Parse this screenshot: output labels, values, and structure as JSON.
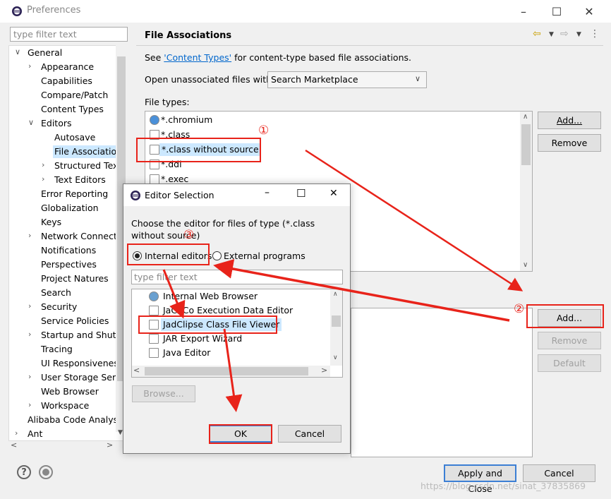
{
  "window": {
    "title": "Preferences"
  },
  "left": {
    "filter_placeholder": "type filter text",
    "tree": [
      {
        "label": "General",
        "depth": 0,
        "twisty": "down"
      },
      {
        "label": "Appearance",
        "depth": 1,
        "twisty": "right"
      },
      {
        "label": "Capabilities",
        "depth": 1,
        "twisty": ""
      },
      {
        "label": "Compare/Patch",
        "depth": 1,
        "twisty": ""
      },
      {
        "label": "Content Types",
        "depth": 1,
        "twisty": ""
      },
      {
        "label": "Editors",
        "depth": 1,
        "twisty": "down"
      },
      {
        "label": "Autosave",
        "depth": 2,
        "twisty": ""
      },
      {
        "label": "File Associations",
        "depth": 2,
        "twisty": "",
        "selected": true
      },
      {
        "label": "Structured Text",
        "depth": 2,
        "twisty": "right"
      },
      {
        "label": "Text Editors",
        "depth": 2,
        "twisty": "right"
      },
      {
        "label": "Error Reporting",
        "depth": 1,
        "twisty": ""
      },
      {
        "label": "Globalization",
        "depth": 1,
        "twisty": ""
      },
      {
        "label": "Keys",
        "depth": 1,
        "twisty": ""
      },
      {
        "label": "Network Connections",
        "depth": 1,
        "twisty": "right"
      },
      {
        "label": "Notifications",
        "depth": 1,
        "twisty": ""
      },
      {
        "label": "Perspectives",
        "depth": 1,
        "twisty": ""
      },
      {
        "label": "Project Natures",
        "depth": 1,
        "twisty": ""
      },
      {
        "label": "Search",
        "depth": 1,
        "twisty": ""
      },
      {
        "label": "Security",
        "depth": 1,
        "twisty": "right"
      },
      {
        "label": "Service Policies",
        "depth": 1,
        "twisty": ""
      },
      {
        "label": "Startup and Shutdown",
        "depth": 1,
        "twisty": "right"
      },
      {
        "label": "Tracing",
        "depth": 1,
        "twisty": ""
      },
      {
        "label": "UI Responsiveness",
        "depth": 1,
        "twisty": ""
      },
      {
        "label": "User Storage Service",
        "depth": 1,
        "twisty": "right"
      },
      {
        "label": "Web Browser",
        "depth": 1,
        "twisty": ""
      },
      {
        "label": "Workspace",
        "depth": 1,
        "twisty": "right"
      },
      {
        "label": "Alibaba Code Analysis",
        "depth": 0,
        "twisty": ""
      },
      {
        "label": "Ant",
        "depth": 0,
        "twisty": "right"
      }
    ]
  },
  "page": {
    "title": "File Associations",
    "see_prefix": "See ",
    "see_link": "'Content Types'",
    "see_suffix": " for content-type based file associations.",
    "open_unassoc_label": "Open unassociated files with:",
    "open_unassoc_value": "Search Marketplace",
    "file_types_label": "File types:",
    "file_types": [
      "*.chromium",
      "*.class",
      "*.class without source",
      "*.ddl",
      "*.exec"
    ],
    "btn_add": "Add...",
    "btn_remove": "Remove",
    "btn_add2": "Add...",
    "btn_remove2": "Remove",
    "btn_default": "Default"
  },
  "bottom": {
    "help_icon": "?",
    "apply_close": "Apply and Close",
    "cancel": "Cancel"
  },
  "dialog": {
    "title": "Editor Selection",
    "prompt": "Choose the editor for files of type (*.class without source)",
    "radio_internal": "Internal editors",
    "radio_external": "External programs",
    "filter_placeholder": "type filter text",
    "editors": [
      "Internal Web Browser",
      "JaCoCo Execution Data Editor",
      "JadClipse Class File Viewer",
      "JAR Export Wizard",
      "Java Editor"
    ],
    "browse": "Browse...",
    "ok": "OK",
    "cancel": "Cancel"
  },
  "annotations": {
    "n1": "①",
    "n2": "②",
    "n3": "③"
  },
  "watermark": "https://blog.csdn.net/sinat_37835869",
  "colors": {
    "annotation_red": "#e8231a",
    "selection": "#cce8ff",
    "link": "#0066cc"
  }
}
